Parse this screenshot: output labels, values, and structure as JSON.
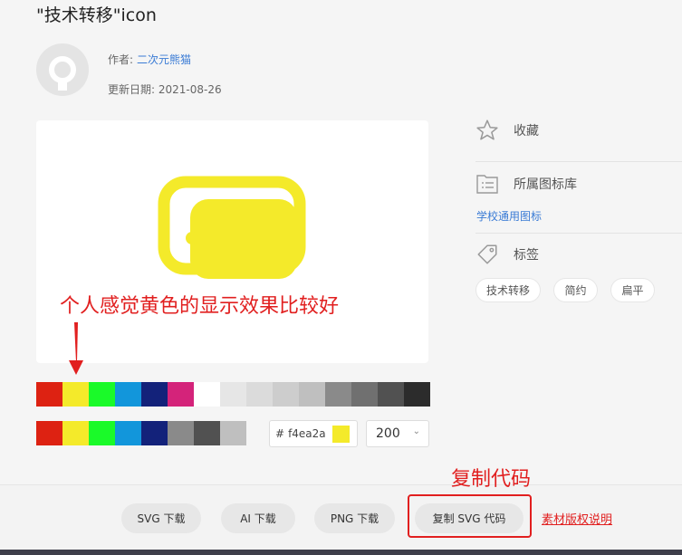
{
  "title": "\"技术转移\"icon",
  "author": {
    "label": "作者:",
    "name": "二次元熊猫"
  },
  "updated": {
    "label": "更新日期:",
    "value": "2021-08-26"
  },
  "annotations": {
    "color_note": "个人感觉黄色的显示效果比较好",
    "copy_note": "复制代码"
  },
  "palette_row1": [
    "#dd2212",
    "#f4ea2a",
    "#1afa29",
    "#1296db",
    "#13227a",
    "#d4237a",
    "#ffffff",
    "#e6e6e6",
    "#dbdbdb",
    "#cdcdcd",
    "#bfbfbf",
    "#8a8a8a",
    "#707070",
    "#515151",
    "#2c2c2c"
  ],
  "palette_row2": [
    "#dd2212",
    "#f4ea2a",
    "#1afa29",
    "#1296db",
    "#13227a",
    "#8a8a8a",
    "#515151",
    "#bfbfbf"
  ],
  "color_input": {
    "hash": "#",
    "value": "f4ea2a",
    "chip": "#f4ea2a"
  },
  "size_select": {
    "value": "200"
  },
  "sidebar": {
    "favorite": "收藏",
    "library_label": "所属图标库",
    "library_name": "学校通用图标",
    "tags_label": "标签",
    "tags": [
      "技术转移",
      "简约",
      "扁平"
    ]
  },
  "buttons": {
    "svg": "SVG 下载",
    "ai": "AI 下载",
    "png": "PNG 下载",
    "copy_svg": "复制 SVG 代码"
  },
  "license": "素材版权说明",
  "icon_color": "#f4ea2a",
  "annotation_color": "#e11f1f",
  "link_color": "#3a7bd5"
}
